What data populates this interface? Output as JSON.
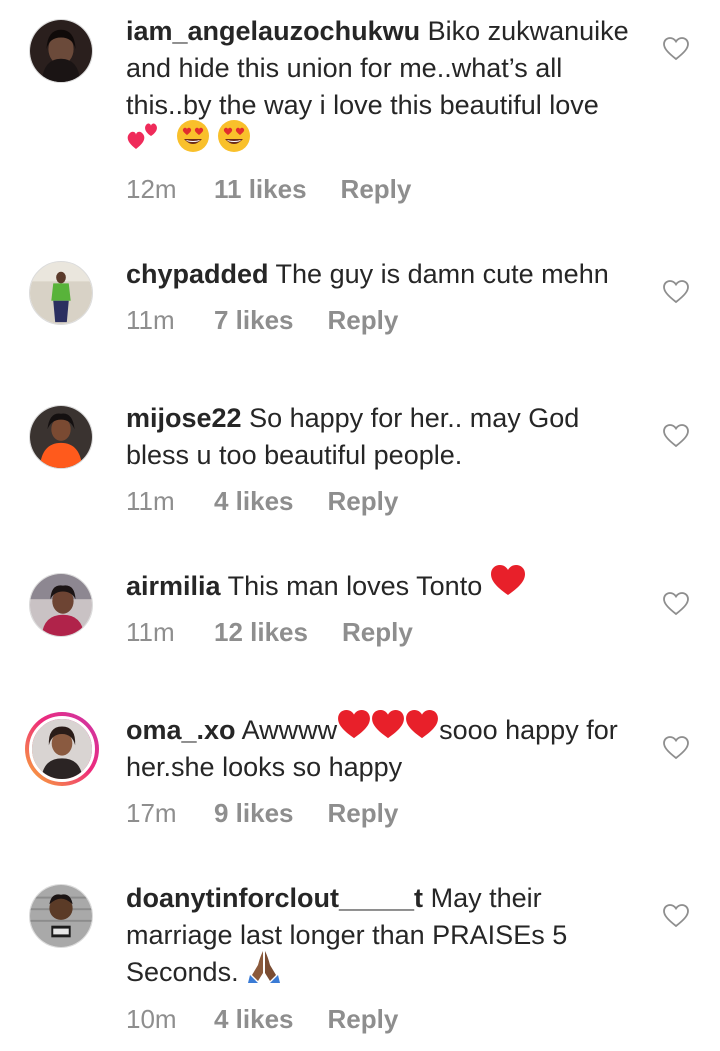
{
  "comments": [
    {
      "username": "iam_angelauzochukwu",
      "text": "Biko zukwanuike and hide this union for me..what’s all this..by the way i love this beautiful love",
      "time": "12m",
      "likes": "11 likes",
      "reply": "Reply",
      "emojis": [
        "two-hearts-emoji",
        "heart-eyes-emoji",
        "heart-eyes-emoji"
      ]
    },
    {
      "username": "chypadded",
      "text": "The guy is damn cute mehn",
      "time": "11m",
      "likes": "7 likes",
      "reply": "Reply"
    },
    {
      "username": "mijose22",
      "text": "So happy for her.. may God bless u too beautiful people.",
      "time": "11m",
      "likes": "4 likes",
      "reply": "Reply"
    },
    {
      "username": "airmilia",
      "text": "This man loves Tonto",
      "time": "11m",
      "likes": "12 likes",
      "reply": "Reply",
      "emojis": [
        "red-heart-emoji"
      ]
    },
    {
      "username": "oma_.xo",
      "text_before": "Awwww",
      "text_after": "sooo happy for her.she looks so happy",
      "time": "17m",
      "likes": "9 likes",
      "reply": "Reply",
      "emojis": [
        "red-heart-emoji",
        "red-heart-emoji",
        "red-heart-emoji"
      ],
      "story_ring": true
    },
    {
      "username": "doanytinforclout_____t",
      "text": "May their marriage last  longer than PRAISEs 5 Seconds.",
      "time": "10m",
      "likes": "4 likes",
      "reply": "Reply",
      "emojis": [
        "folded-hands-emoji"
      ]
    }
  ],
  "icons": {
    "like": "heart-outline-icon"
  },
  "colors": {
    "text": "#262626",
    "meta": "#8e8e8e",
    "story_gradient": [
      "#f9b233",
      "#ee2a7b",
      "#c837ab"
    ]
  }
}
